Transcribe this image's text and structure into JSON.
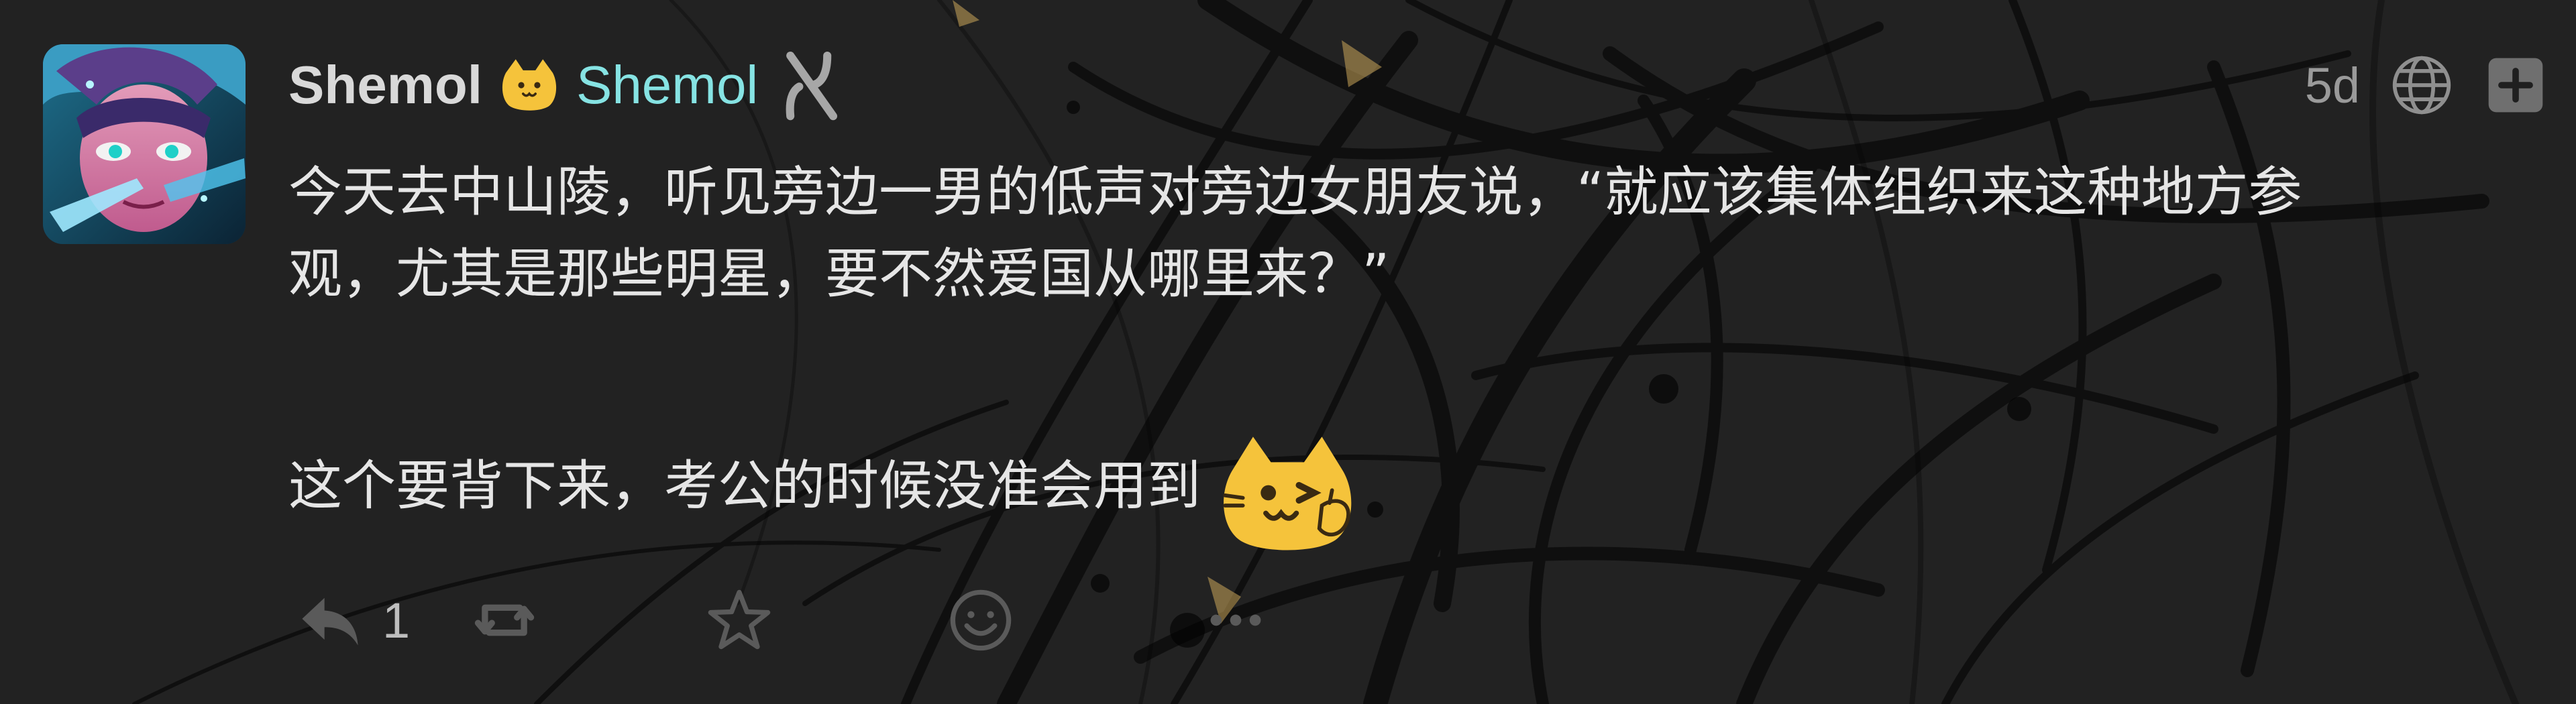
{
  "note": {
    "author": {
      "display_name": "Shemol",
      "handle": "Shemol",
      "avatar_icon": "anime-avatar",
      "badge_icon": "cat-face-icon",
      "instance_icon": "aleph-icon"
    },
    "time": "5d",
    "visibility_icon": "globe-icon",
    "more_icon": "plus-icon",
    "body": {
      "lines": [
        "今天去中山陵，听见旁边一男的低声对旁边女朋友说，“就应该集体组织来这种地方参",
        "观，尤其是那些明星，要不然爱国从哪里来？”",
        "这个要背下来，考公的时候没准会用到"
      ],
      "emoji": "wink-cat-emoji"
    },
    "actions": {
      "reply_count": "1",
      "reply_icon": "reply-icon",
      "renote_icon": "renote-icon",
      "favorite_icon": "star-icon",
      "reaction_icon": "smiley-icon",
      "more_icon": "ellipsis-icon"
    }
  },
  "colors": {
    "background": "#232323",
    "text": "#e6e6e6",
    "username": "#d9d9d9",
    "handle": "#86e3e3",
    "muted": "#9a9a9a",
    "cat_yellow": "#f5c33b"
  }
}
